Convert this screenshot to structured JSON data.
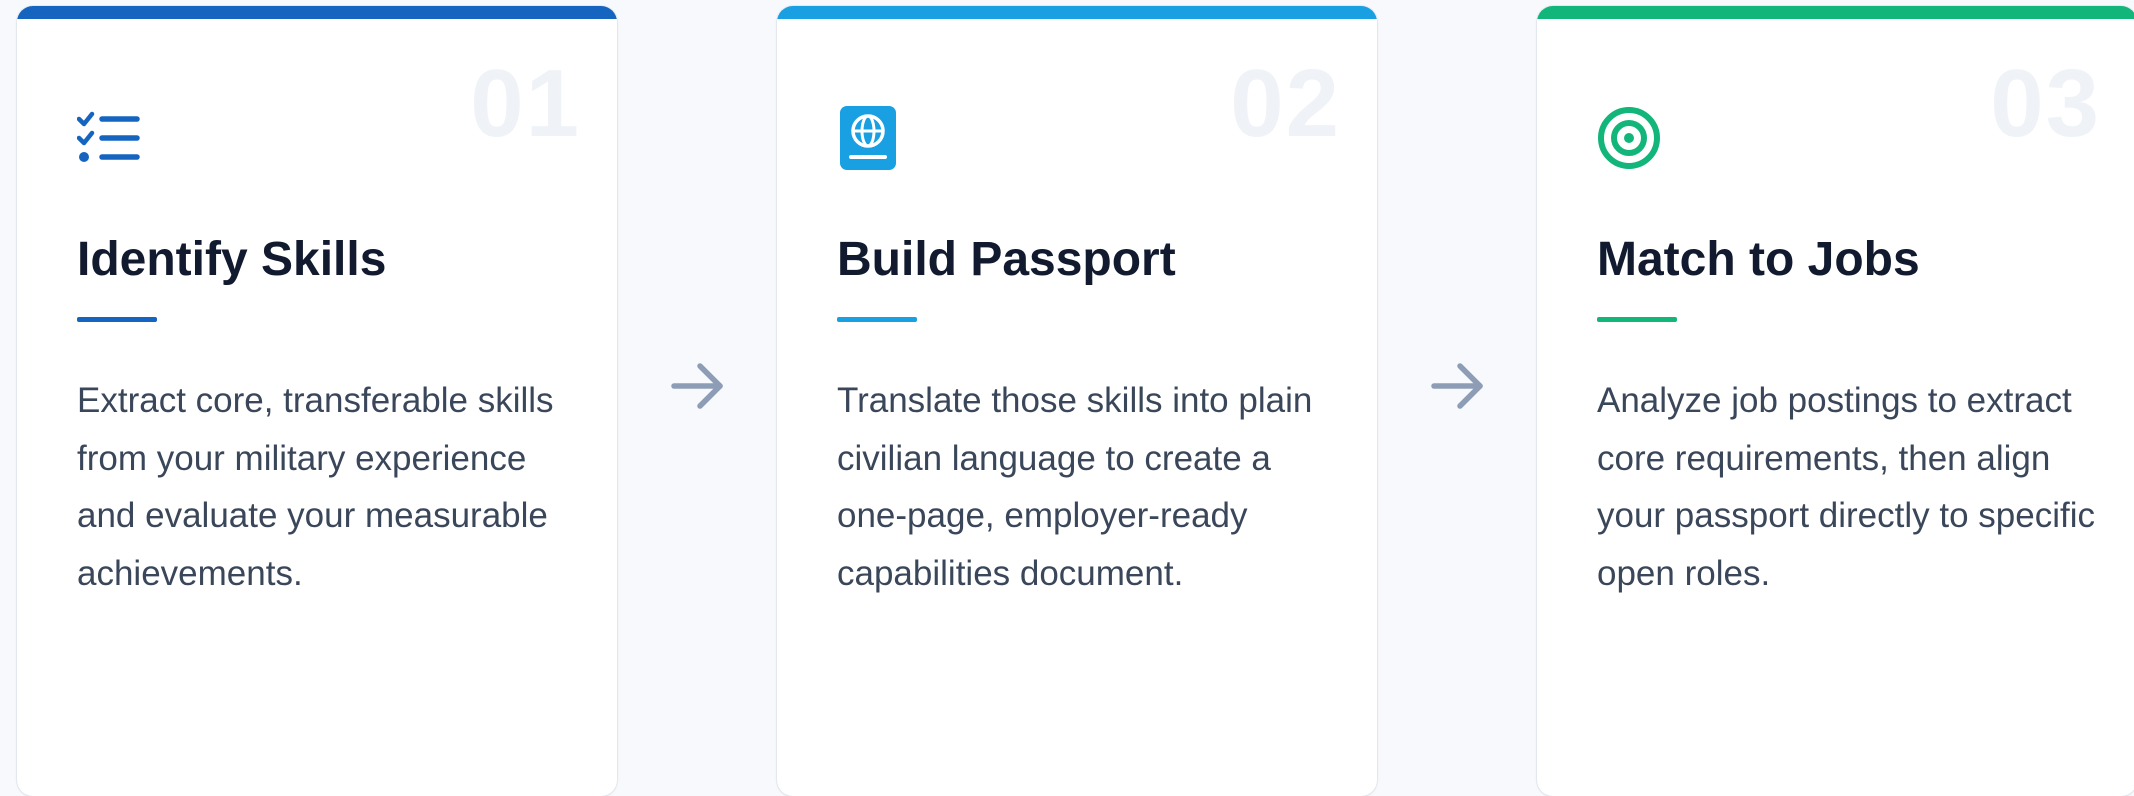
{
  "colors": {
    "card1_accent": "#1565c0",
    "card2_accent": "#18a0e2",
    "card3_accent": "#12b57a",
    "arrow": "#8d9db6"
  },
  "steps": [
    {
      "number": "01",
      "icon": "checklist-icon",
      "title": "Identify Skills",
      "description": "Extract core, transferable skills from your military experience and evaluate your measurable achievements."
    },
    {
      "number": "02",
      "icon": "passport-icon",
      "title": "Build Passport",
      "description": "Translate those skills into plain civilian language to create a one-page, employer-ready capabilities document."
    },
    {
      "number": "03",
      "icon": "target-icon",
      "title": "Match to Jobs",
      "description": "Analyze job postings to extract core requirements, then align your passport directly to specific open roles."
    }
  ]
}
